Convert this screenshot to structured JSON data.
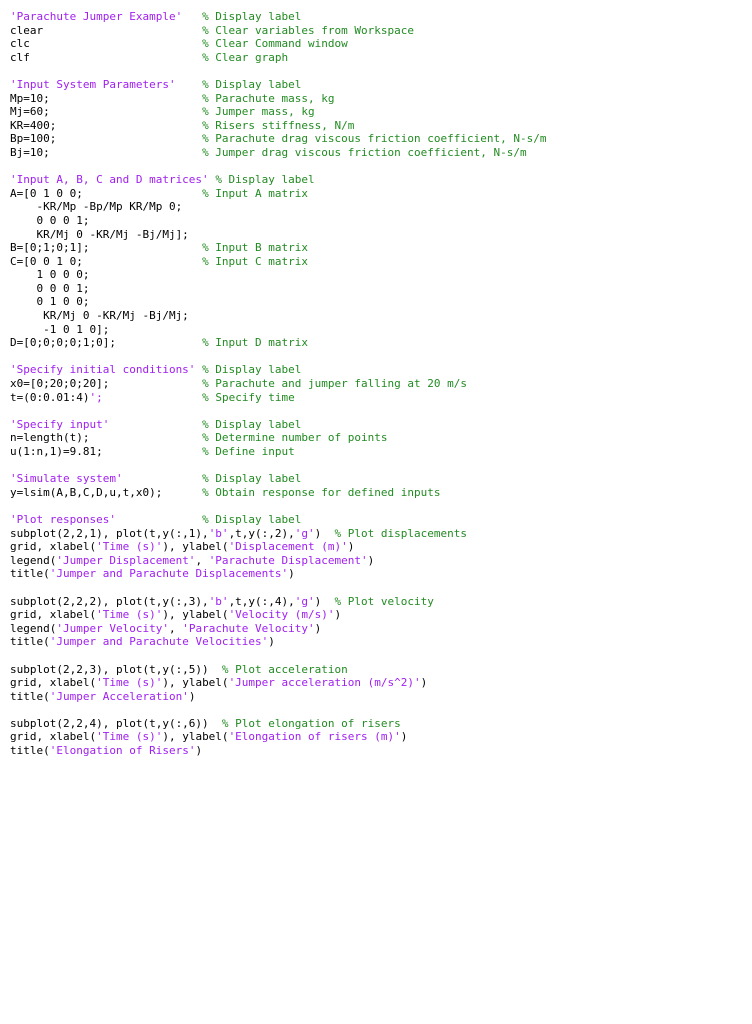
{
  "editor": {
    "language": "MATLAB",
    "background_color": "#ffffff",
    "colors": {
      "code": "#000000",
      "string": "#A020F0",
      "comment": "#228B22"
    },
    "comment_column": 28,
    "lines": [
      {
        "index": 1,
        "text": "'Parachute Jumper Example'   % Display label",
        "tokens": [
          {
            "type": "string",
            "text": "'Parachute Jumper Example'"
          },
          {
            "type": "code",
            "text": "   "
          },
          {
            "type": "comment",
            "text": "% Display label"
          }
        ]
      },
      {
        "index": 2,
        "text": "clear                        % Clear variables from Workspace",
        "tokens": [
          {
            "type": "code",
            "text": "clear                        "
          },
          {
            "type": "comment",
            "text": "% Clear variables from Workspace"
          }
        ]
      },
      {
        "index": 3,
        "text": "clc                          % Clear Command window",
        "tokens": [
          {
            "type": "code",
            "text": "clc                          "
          },
          {
            "type": "comment",
            "text": "% Clear Command window"
          }
        ]
      },
      {
        "index": 4,
        "text": "clf                          % Clear graph",
        "tokens": [
          {
            "type": "code",
            "text": "clf                          "
          },
          {
            "type": "comment",
            "text": "% Clear graph"
          }
        ]
      },
      {
        "index": 5,
        "text": "",
        "tokens": []
      },
      {
        "index": 6,
        "text": "'Input System Parameters'    % Display label",
        "tokens": [
          {
            "type": "string",
            "text": "'Input System Parameters'"
          },
          {
            "type": "code",
            "text": "    "
          },
          {
            "type": "comment",
            "text": "% Display label"
          }
        ]
      },
      {
        "index": 7,
        "text": "Mp=10;                       % Parachute mass, kg",
        "tokens": [
          {
            "type": "code",
            "text": "Mp=10;                       "
          },
          {
            "type": "comment",
            "text": "% Parachute mass, kg"
          }
        ]
      },
      {
        "index": 8,
        "text": "Mj=60;                       % Jumper mass, kg",
        "tokens": [
          {
            "type": "code",
            "text": "Mj=60;                       "
          },
          {
            "type": "comment",
            "text": "% Jumper mass, kg"
          }
        ]
      },
      {
        "index": 9,
        "text": "KR=400;                      % Risers stiffness, N/m",
        "tokens": [
          {
            "type": "code",
            "text": "KR=400;                      "
          },
          {
            "type": "comment",
            "text": "% Risers stiffness, N/m"
          }
        ]
      },
      {
        "index": 10,
        "text": "Bp=100;                      % Parachute drag viscous friction coefficient, N-s/m",
        "tokens": [
          {
            "type": "code",
            "text": "Bp=100;                      "
          },
          {
            "type": "comment",
            "text": "% Parachute drag viscous friction coefficient, N-s/m"
          }
        ]
      },
      {
        "index": 11,
        "text": "Bj=10;                       % Jumper drag viscous friction coefficient, N-s/m",
        "tokens": [
          {
            "type": "code",
            "text": "Bj=10;                       "
          },
          {
            "type": "comment",
            "text": "% Jumper drag viscous friction coefficient, N-s/m"
          }
        ]
      },
      {
        "index": 12,
        "text": "",
        "tokens": []
      },
      {
        "index": 13,
        "text": "'Input A, B, C and D matrices' % Display label",
        "tokens": [
          {
            "type": "string",
            "text": "'Input A, B, C and D matrices'"
          },
          {
            "type": "code",
            "text": " "
          },
          {
            "type": "comment",
            "text": "% Display label"
          }
        ]
      },
      {
        "index": 14,
        "text": "A=[0 1 0 0;                  % Input A matrix",
        "tokens": [
          {
            "type": "code",
            "text": "A=[0 1 0 0;                  "
          },
          {
            "type": "comment",
            "text": "% Input A matrix"
          }
        ]
      },
      {
        "index": 15,
        "text": "    -KR/Mp -Bp/Mp KR/Mp 0;",
        "tokens": [
          {
            "type": "code",
            "text": "    -KR/Mp -Bp/Mp KR/Mp 0;"
          }
        ]
      },
      {
        "index": 16,
        "text": "    0 0 0 1;",
        "tokens": [
          {
            "type": "code",
            "text": "    0 0 0 1;"
          }
        ]
      },
      {
        "index": 17,
        "text": "    KR/Mj 0 -KR/Mj -Bj/Mj];",
        "tokens": [
          {
            "type": "code",
            "text": "    KR/Mj 0 -KR/Mj -Bj/Mj];"
          }
        ]
      },
      {
        "index": 18,
        "text": "B=[0;1;0;1];                 % Input B matrix",
        "tokens": [
          {
            "type": "code",
            "text": "B=[0;1;0;1];                 "
          },
          {
            "type": "comment",
            "text": "% Input B matrix"
          }
        ]
      },
      {
        "index": 19,
        "text": "C=[0 0 1 0;                  % Input C matrix",
        "tokens": [
          {
            "type": "code",
            "text": "C=[0 0 1 0;                  "
          },
          {
            "type": "comment",
            "text": "% Input C matrix"
          }
        ]
      },
      {
        "index": 20,
        "text": "    1 0 0 0;",
        "tokens": [
          {
            "type": "code",
            "text": "    1 0 0 0;"
          }
        ]
      },
      {
        "index": 21,
        "text": "    0 0 0 1;",
        "tokens": [
          {
            "type": "code",
            "text": "    0 0 0 1;"
          }
        ]
      },
      {
        "index": 22,
        "text": "    0 1 0 0;",
        "tokens": [
          {
            "type": "code",
            "text": "    0 1 0 0;"
          }
        ]
      },
      {
        "index": 23,
        "text": "     KR/Mj 0 -KR/Mj -Bj/Mj;",
        "tokens": [
          {
            "type": "code",
            "text": "     KR/Mj 0 -KR/Mj -Bj/Mj;"
          }
        ]
      },
      {
        "index": 24,
        "text": "     -1 0 1 0];",
        "tokens": [
          {
            "type": "code",
            "text": "     -1 0 1 0];"
          }
        ]
      },
      {
        "index": 25,
        "text": "D=[0;0;0;0;1;0];             % Input D matrix",
        "tokens": [
          {
            "type": "code",
            "text": "D=[0;0;0;0;1;0];             "
          },
          {
            "type": "comment",
            "text": "% Input D matrix"
          }
        ]
      },
      {
        "index": 26,
        "text": "",
        "tokens": []
      },
      {
        "index": 27,
        "text": "'Specify initial conditions' % Display label",
        "tokens": [
          {
            "type": "string",
            "text": "'Specify initial conditions'"
          },
          {
            "type": "code",
            "text": " "
          },
          {
            "type": "comment",
            "text": "% Display label"
          }
        ]
      },
      {
        "index": 28,
        "text": "x0=[0;20;0;20];              % Parachute and jumper falling at 20 m/s",
        "tokens": [
          {
            "type": "code",
            "text": "x0=[0;20;0;20];              "
          },
          {
            "type": "comment",
            "text": "% Parachute and jumper falling at 20 m/s"
          }
        ]
      },
      {
        "index": 29,
        "text": "t=(0:0.01:4)';               % Specify time",
        "tokens": [
          {
            "type": "code",
            "text": "t=(0:0.01:4)"
          },
          {
            "type": "string",
            "text": "';"
          },
          {
            "type": "code",
            "text": "               "
          },
          {
            "type": "comment",
            "text": "% Specify time"
          }
        ]
      },
      {
        "index": 30,
        "text": "",
        "tokens": []
      },
      {
        "index": 31,
        "text": "'Specify input'              % Display label",
        "tokens": [
          {
            "type": "string",
            "text": "'Specify input'"
          },
          {
            "type": "code",
            "text": "              "
          },
          {
            "type": "comment",
            "text": "% Display label"
          }
        ]
      },
      {
        "index": 32,
        "text": "n=length(t);                 % Determine number of points",
        "tokens": [
          {
            "type": "code",
            "text": "n=length(t);                 "
          },
          {
            "type": "comment",
            "text": "% Determine number of points"
          }
        ]
      },
      {
        "index": 33,
        "text": "u(1:n,1)=9.81;               % Define input",
        "tokens": [
          {
            "type": "code",
            "text": "u(1:n,1)=9.81;               "
          },
          {
            "type": "comment",
            "text": "% Define input"
          }
        ]
      },
      {
        "index": 34,
        "text": "",
        "tokens": []
      },
      {
        "index": 35,
        "text": "'Simulate system'            % Display label",
        "tokens": [
          {
            "type": "string",
            "text": "'Simulate system'"
          },
          {
            "type": "code",
            "text": "            "
          },
          {
            "type": "comment",
            "text": "% Display label"
          }
        ]
      },
      {
        "index": 36,
        "text": "y=lsim(A,B,C,D,u,t,x0);      % Obtain response for defined inputs",
        "tokens": [
          {
            "type": "code",
            "text": "y=lsim(A,B,C,D,u,t,x0);      "
          },
          {
            "type": "comment",
            "text": "% Obtain response for defined inputs"
          }
        ]
      },
      {
        "index": 37,
        "text": "",
        "tokens": []
      },
      {
        "index": 38,
        "text": "'Plot responses'             % Display label",
        "tokens": [
          {
            "type": "string",
            "text": "'Plot responses'"
          },
          {
            "type": "code",
            "text": "             "
          },
          {
            "type": "comment",
            "text": "% Display label"
          }
        ]
      },
      {
        "index": 39,
        "text": "subplot(2,2,1), plot(t,y(:,1),'b',t,y(:,2),'g')  % Plot displacements",
        "tokens": [
          {
            "type": "code",
            "text": "subplot(2,2,1), plot(t,y(:,1),"
          },
          {
            "type": "string",
            "text": "'b'"
          },
          {
            "type": "code",
            "text": ",t,y(:,2),"
          },
          {
            "type": "string",
            "text": "'g'"
          },
          {
            "type": "code",
            "text": ")  "
          },
          {
            "type": "comment",
            "text": "% Plot displacements"
          }
        ]
      },
      {
        "index": 40,
        "text": "grid, xlabel('Time (s)'), ylabel('Displacement (m)')",
        "tokens": [
          {
            "type": "code",
            "text": "grid, xlabel("
          },
          {
            "type": "string",
            "text": "'Time (s)'"
          },
          {
            "type": "code",
            "text": "), ylabel("
          },
          {
            "type": "string",
            "text": "'Displacement (m)'"
          },
          {
            "type": "code",
            "text": ")"
          }
        ]
      },
      {
        "index": 41,
        "text": "legend('Jumper Displacement', 'Parachute Displacement')",
        "tokens": [
          {
            "type": "code",
            "text": "legend("
          },
          {
            "type": "string",
            "text": "'Jumper Displacement'"
          },
          {
            "type": "code",
            "text": ", "
          },
          {
            "type": "string",
            "text": "'Parachute Displacement'"
          },
          {
            "type": "code",
            "text": ")"
          }
        ]
      },
      {
        "index": 42,
        "text": "title('Jumper and Parachute Displacements')",
        "tokens": [
          {
            "type": "code",
            "text": "title("
          },
          {
            "type": "string",
            "text": "'Jumper and Parachute Displacements'"
          },
          {
            "type": "code",
            "text": ")"
          }
        ]
      },
      {
        "index": 43,
        "text": "",
        "tokens": []
      },
      {
        "index": 44,
        "text": "subplot(2,2,2), plot(t,y(:,3),'b',t,y(:,4),'g')  % Plot velocity",
        "tokens": [
          {
            "type": "code",
            "text": "subplot(2,2,2), plot(t,y(:,3),"
          },
          {
            "type": "string",
            "text": "'b'"
          },
          {
            "type": "code",
            "text": ",t,y(:,4),"
          },
          {
            "type": "string",
            "text": "'g'"
          },
          {
            "type": "code",
            "text": ")  "
          },
          {
            "type": "comment",
            "text": "% Plot velocity"
          }
        ]
      },
      {
        "index": 45,
        "text": "grid, xlabel('Time (s)'), ylabel('Velocity (m/s)')",
        "tokens": [
          {
            "type": "code",
            "text": "grid, xlabel("
          },
          {
            "type": "string",
            "text": "'Time (s)'"
          },
          {
            "type": "code",
            "text": "), ylabel("
          },
          {
            "type": "string",
            "text": "'Velocity (m/s)'"
          },
          {
            "type": "code",
            "text": ")"
          }
        ]
      },
      {
        "index": 46,
        "text": "legend('Jumper Velocity', 'Parachute Velocity')",
        "tokens": [
          {
            "type": "code",
            "text": "legend("
          },
          {
            "type": "string",
            "text": "'Jumper Velocity'"
          },
          {
            "type": "code",
            "text": ", "
          },
          {
            "type": "string",
            "text": "'Parachute Velocity'"
          },
          {
            "type": "code",
            "text": ")"
          }
        ]
      },
      {
        "index": 47,
        "text": "title('Jumper and Parachute Velocities')",
        "tokens": [
          {
            "type": "code",
            "text": "title("
          },
          {
            "type": "string",
            "text": "'Jumper and Parachute Velocities'"
          },
          {
            "type": "code",
            "text": ")"
          }
        ]
      },
      {
        "index": 48,
        "text": "",
        "tokens": []
      },
      {
        "index": 49,
        "text": "subplot(2,2,3), plot(t,y(:,5))  % Plot acceleration",
        "tokens": [
          {
            "type": "code",
            "text": "subplot(2,2,3), plot(t,y(:,5))  "
          },
          {
            "type": "comment",
            "text": "% Plot acceleration"
          }
        ]
      },
      {
        "index": 50,
        "text": "grid, xlabel('Time (s)'), ylabel('Jumper acceleration (m/s^2)')",
        "tokens": [
          {
            "type": "code",
            "text": "grid, xlabel("
          },
          {
            "type": "string",
            "text": "'Time (s)'"
          },
          {
            "type": "code",
            "text": "), ylabel("
          },
          {
            "type": "string",
            "text": "'Jumper acceleration (m/s^2)'"
          },
          {
            "type": "code",
            "text": ")"
          }
        ]
      },
      {
        "index": 51,
        "text": "title('Jumper Acceleration')",
        "tokens": [
          {
            "type": "code",
            "text": "title("
          },
          {
            "type": "string",
            "text": "'Jumper Acceleration'"
          },
          {
            "type": "code",
            "text": ")"
          }
        ]
      },
      {
        "index": 52,
        "text": "",
        "tokens": []
      },
      {
        "index": 53,
        "text": "subplot(2,2,4), plot(t,y(:,6))  % Plot elongation of risers",
        "tokens": [
          {
            "type": "code",
            "text": "subplot(2,2,4), plot(t,y(:,6))  "
          },
          {
            "type": "comment",
            "text": "% Plot elongation of risers"
          }
        ]
      },
      {
        "index": 54,
        "text": "grid, xlabel('Time (s)'), ylabel('Elongation of risers (m)')",
        "tokens": [
          {
            "type": "code",
            "text": "grid, xlabel("
          },
          {
            "type": "string",
            "text": "'Time (s)'"
          },
          {
            "type": "code",
            "text": "), ylabel("
          },
          {
            "type": "string",
            "text": "'Elongation of risers (m)'"
          },
          {
            "type": "code",
            "text": ")"
          }
        ]
      },
      {
        "index": 55,
        "text": "title('Elongation of Risers')",
        "tokens": [
          {
            "type": "code",
            "text": "title("
          },
          {
            "type": "string",
            "text": "'Elongation of Risers'"
          },
          {
            "type": "code",
            "text": ")"
          }
        ]
      }
    ]
  }
}
